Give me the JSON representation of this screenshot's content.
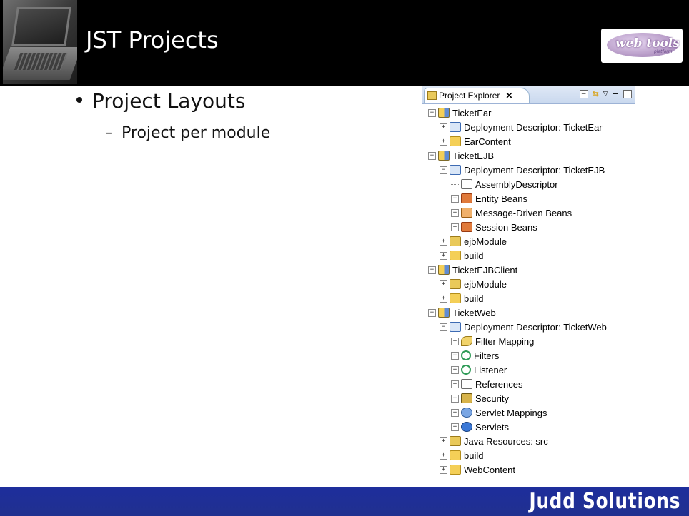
{
  "header": {
    "title": "JST Projects",
    "logo": {
      "text": "web tools",
      "subtext": "platform"
    }
  },
  "bullets": {
    "level1": "Project Layouts",
    "level2": "Project per module"
  },
  "explorer": {
    "tab_label": "Project Explorer",
    "close_glyph": "✕",
    "tree": [
      {
        "label": "TicketEar",
        "depth": 0,
        "toggle": "−",
        "icon": "ic-proj",
        "icon_name": "enterprise-project-icon"
      },
      {
        "label": "Deployment Descriptor: TicketEar",
        "depth": 1,
        "toggle": "+",
        "icon": "ic-dd",
        "icon_name": "deployment-descriptor-icon"
      },
      {
        "label": "EarContent",
        "depth": 1,
        "toggle": "+",
        "icon": "ic-folder",
        "icon_name": "folder-icon"
      },
      {
        "label": "TicketEJB",
        "depth": 0,
        "toggle": "−",
        "icon": "ic-proj",
        "icon_name": "ejb-project-icon"
      },
      {
        "label": "Deployment Descriptor: TicketEJB",
        "depth": 1,
        "toggle": "−",
        "icon": "ic-dd",
        "icon_name": "deployment-descriptor-icon"
      },
      {
        "label": "AssemblyDescriptor",
        "depth": 2,
        "toggle": "",
        "icon": "ic-doc",
        "icon_name": "assembly-descriptor-icon"
      },
      {
        "label": "Entity Beans",
        "depth": 2,
        "toggle": "+",
        "icon": "ic-bean",
        "icon_name": "entity-bean-icon"
      },
      {
        "label": "Message-Driven Beans",
        "depth": 2,
        "toggle": "+",
        "icon": "ic-mdb",
        "icon_name": "message-driven-bean-icon"
      },
      {
        "label": "Session Beans",
        "depth": 2,
        "toggle": "+",
        "icon": "ic-bean",
        "icon_name": "session-bean-icon"
      },
      {
        "label": "ejbModule",
        "depth": 1,
        "toggle": "+",
        "icon": "ic-jar",
        "icon_name": "source-folder-icon"
      },
      {
        "label": "build",
        "depth": 1,
        "toggle": "+",
        "icon": "ic-folder",
        "icon_name": "folder-icon"
      },
      {
        "label": "TicketEJBClient",
        "depth": 0,
        "toggle": "−",
        "icon": "ic-proj",
        "icon_name": "client-project-icon"
      },
      {
        "label": "ejbModule",
        "depth": 1,
        "toggle": "+",
        "icon": "ic-jar",
        "icon_name": "source-folder-icon"
      },
      {
        "label": "build",
        "depth": 1,
        "toggle": "+",
        "icon": "ic-folder",
        "icon_name": "folder-icon"
      },
      {
        "label": "TicketWeb",
        "depth": 0,
        "toggle": "−",
        "icon": "ic-proj",
        "icon_name": "web-project-icon"
      },
      {
        "label": "Deployment Descriptor: TicketWeb",
        "depth": 1,
        "toggle": "−",
        "icon": "ic-dd",
        "icon_name": "deployment-descriptor-icon"
      },
      {
        "label": "Filter Mapping",
        "depth": 2,
        "toggle": "+",
        "icon": "ic-filter",
        "icon_name": "filter-mapping-icon"
      },
      {
        "label": "Filters",
        "depth": 2,
        "toggle": "+",
        "icon": "ic-green",
        "icon_name": "filters-icon"
      },
      {
        "label": "Listener",
        "depth": 2,
        "toggle": "+",
        "icon": "ic-green",
        "icon_name": "listener-icon"
      },
      {
        "label": "References",
        "depth": 2,
        "toggle": "+",
        "icon": "ic-doc",
        "icon_name": "references-icon"
      },
      {
        "label": "Security",
        "depth": 2,
        "toggle": "+",
        "icon": "ic-sec",
        "icon_name": "security-icon"
      },
      {
        "label": "Servlet Mappings",
        "depth": 2,
        "toggle": "+",
        "icon": "ic-map",
        "icon_name": "servlet-mappings-icon"
      },
      {
        "label": "Servlets",
        "depth": 2,
        "toggle": "+",
        "icon": "ic-serv",
        "icon_name": "servlets-icon"
      },
      {
        "label": "Java Resources: src",
        "depth": 1,
        "toggle": "+",
        "icon": "ic-jar",
        "icon_name": "java-resources-icon"
      },
      {
        "label": "build",
        "depth": 1,
        "toggle": "+",
        "icon": "ic-folder",
        "icon_name": "folder-icon"
      },
      {
        "label": "WebContent",
        "depth": 1,
        "toggle": "+",
        "icon": "ic-folder",
        "icon_name": "folder-icon"
      }
    ]
  },
  "footer": {
    "brand": "Judd Solutions"
  }
}
